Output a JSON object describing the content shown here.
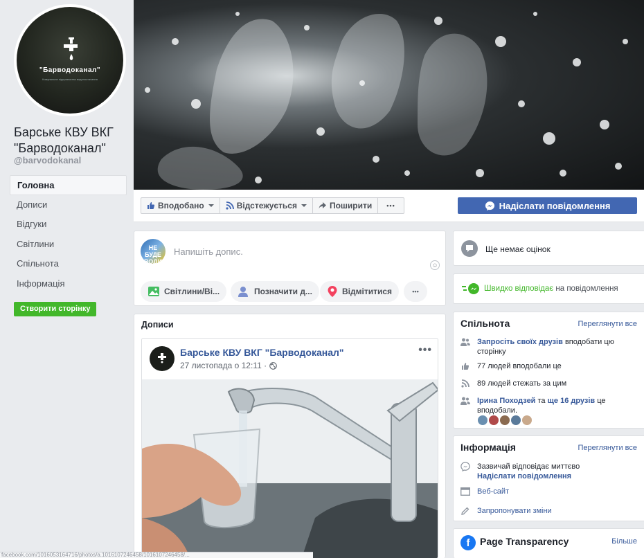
{
  "page": {
    "name": "Барське КВУ ВКГ \"Барводоканал\"",
    "handle": "@barvodokanal",
    "avatar_brand": "\"Барводоканал\"",
    "avatar_sub": "Комунальне підприємство водопостачання"
  },
  "nav": [
    {
      "label": "Головна",
      "active": true
    },
    {
      "label": "Дописи"
    },
    {
      "label": "Відгуки"
    },
    {
      "label": "Світлини"
    },
    {
      "label": "Спільнота"
    },
    {
      "label": "Інформація"
    }
  ],
  "create_page": "Створити сторінку",
  "actions": {
    "like": "Вподобано",
    "follow": "Відстежується",
    "share": "Поширити",
    "more": "•••",
    "message": "Надіслати повідомлення"
  },
  "composer": {
    "placeholder": "Напишіть допис.",
    "avatar_text": "НЕ БУДЕ ВОДИ",
    "photo": "Світлини/Ві...",
    "tag": "Позначити д...",
    "checkin": "Відмітитися",
    "more": "•••"
  },
  "posts": {
    "title": "Дописи",
    "author": "Барське КВУ ВКГ \"Барводоканал\"",
    "date": "27 листопада о 12:11 ·",
    "more": "•••"
  },
  "status_url": "facebook.com/1016053164716/photos/a.1016107246458/1016107246458/...",
  "right": {
    "rating": "Ще немає оцінок",
    "response_fast": "Швидко відповідає",
    "response_rest": "на повідомлення",
    "community": {
      "title": "Спільнота",
      "see_all": "Переглянути все",
      "invite_link": "Запросіть своїх друзів",
      "invite_rest": "вподобати цю сторінку",
      "likes": "77 людей вподобали це",
      "follows": "89 людей стежать за цим",
      "friend_name": "Ірина Походзей",
      "friend_mid": "та",
      "friend_more": "ще 16 друзів",
      "friend_rest": "це вподобали."
    },
    "info": {
      "title": "Інформація",
      "see_all": "Переглянути все",
      "replies": "Зазвичай відповідає миттєво",
      "send_msg": "Надіслати повідомлення",
      "website": "Веб-сайт",
      "suggest": "Запропонувати зміни"
    },
    "transparency": {
      "title": "Page Transparency",
      "more": "Більше"
    }
  },
  "colors": {
    "fb_blue": "#4267b2",
    "link": "#365899",
    "green": "#42b72a",
    "bg": "#e9ebee"
  }
}
